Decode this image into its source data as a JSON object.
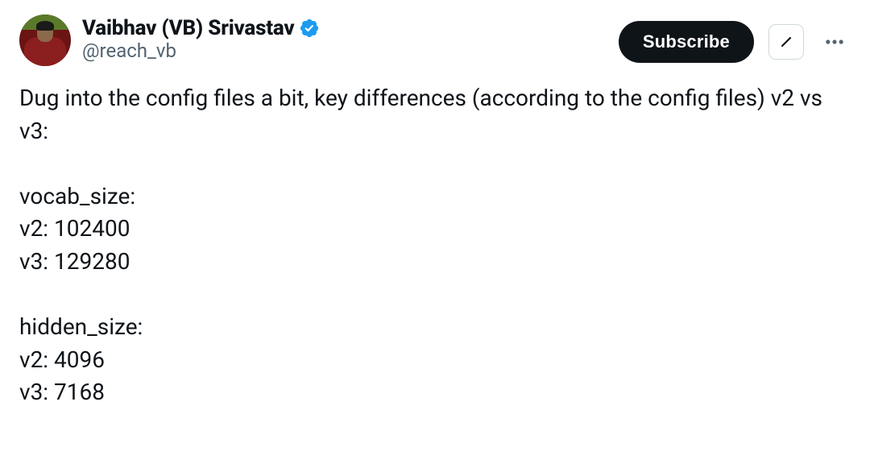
{
  "header": {
    "display_name": "Vaibhav (VB) Srivastav",
    "handle": "@reach_vb",
    "subscribe_label": "Subscribe"
  },
  "tweet": {
    "intro": "Dug into the config files a bit, key differences (according to the config files) v2 vs v3:",
    "sections": [
      {
        "label": "vocab_size:",
        "v2": "v2: 102400",
        "v3": "v3: 129280"
      },
      {
        "label": "hidden_size:",
        "v2": "v2: 4096",
        "v3": "v3: 7168"
      }
    ]
  }
}
